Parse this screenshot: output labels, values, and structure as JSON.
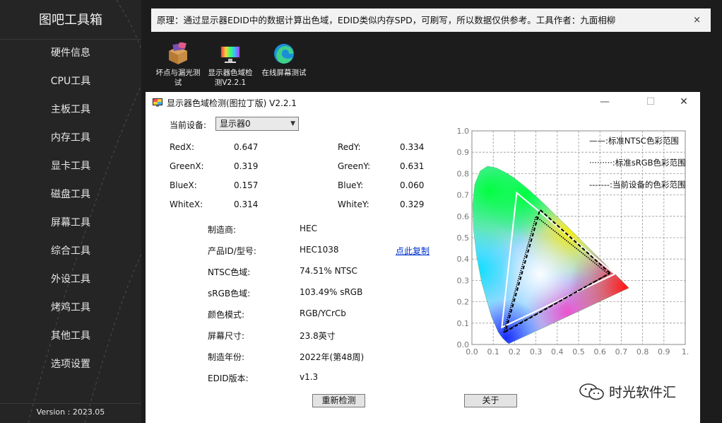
{
  "sidebar": {
    "title": "图吧工具箱",
    "items": [
      {
        "label": "硬件信息"
      },
      {
        "label": "CPU工具"
      },
      {
        "label": "主板工具"
      },
      {
        "label": "内存工具"
      },
      {
        "label": "显卡工具"
      },
      {
        "label": "磁盘工具"
      },
      {
        "label": "屏幕工具"
      },
      {
        "label": "综合工具"
      },
      {
        "label": "外设工具"
      },
      {
        "label": "烤鸡工具"
      },
      {
        "label": "其他工具"
      },
      {
        "label": "选项设置"
      }
    ],
    "version": "Version : 2023.05"
  },
  "infobar": {
    "text": "原理：通过显示器EDID中的数据计算出色域，EDID类似内存SPD，可刷写，所以数据仅供参考。工具作者：九面相柳",
    "close": "×"
  },
  "shortcuts": [
    {
      "line1": "坏点与漏光测",
      "line2": "试",
      "icon": "box-tool-icon"
    },
    {
      "line1": "显示器色域检",
      "line2": "测V2.2.1",
      "icon": "monitor-icon"
    },
    {
      "line1": "在线屏幕测试",
      "line2": "",
      "icon": "edge-browser-icon"
    }
  ],
  "window": {
    "title": "显示器色域检测(图拉丁版) V2.2.1",
    "minimize": "—",
    "maximize": "☐",
    "close": "✕",
    "device_label": "当前设备:",
    "device_value": "显示器0",
    "coords": {
      "red_x": {
        "label": "RedX:",
        "value": "0.647"
      },
      "red_y": {
        "label": "RedY:",
        "value": "0.334"
      },
      "green_x": {
        "label": "GreenX:",
        "value": "0.319"
      },
      "green_y": {
        "label": "GreenY:",
        "value": "0.631"
      },
      "blue_x": {
        "label": "BlueX:",
        "value": "0.157"
      },
      "blue_y": {
        "label": "BlueY:",
        "value": "0.060"
      },
      "white_x": {
        "label": "WhiteX:",
        "value": "0.314"
      },
      "white_y": {
        "label": "WhiteY:",
        "value": "0.329"
      }
    },
    "info": [
      {
        "label": "制造商:",
        "value": "HEC"
      },
      {
        "label": "产品ID/型号:",
        "value": "HEC1038"
      },
      {
        "label": "NTSC色域:",
        "value": "74.51% NTSC"
      },
      {
        "label": "sRGB色域:",
        "value": "103.49% sRGB"
      },
      {
        "label": "颜色模式:",
        "value": "RGB/YCrCb"
      },
      {
        "label": "屏幕尺寸:",
        "value": "23.8英寸"
      },
      {
        "label": "制造年份:",
        "value": "2022年(第48周)"
      },
      {
        "label": "EDID版本:",
        "value": "v1.3"
      }
    ],
    "copy_link": "点此复制",
    "redetect_button": "重新检测",
    "about_button": "关于"
  },
  "chart_data": {
    "type": "scatter",
    "title": "",
    "xlabel": "",
    "ylabel": "",
    "xlim": [
      0,
      1
    ],
    "ylim": [
      0,
      1
    ],
    "x_ticks": [
      "0.0",
      "0.1",
      "0.2",
      "0.3",
      "0.4",
      "0.5",
      "0.6",
      "0.7",
      "0.8",
      "0.9",
      "1."
    ],
    "y_ticks": [
      "0.0",
      "0.1",
      "0.2",
      "0.3",
      "0.4",
      "0.5",
      "0.6",
      "0.7",
      "0.8",
      "0.9",
      "1.0"
    ],
    "grid": true,
    "legend_position": "top-right",
    "series": [
      {
        "name": "标准NTSC色彩范围",
        "legend_text": "——:标准NTSC色彩范围",
        "points": [
          [
            0.67,
            0.33
          ],
          [
            0.21,
            0.71
          ],
          [
            0.14,
            0.08
          ],
          [
            0.67,
            0.33
          ]
        ],
        "color": "#ffffff"
      },
      {
        "name": "标准sRGB色彩范围",
        "legend_text": "·········:标准sRGB色彩范围",
        "points": [
          [
            0.64,
            0.33
          ],
          [
            0.3,
            0.6
          ],
          [
            0.15,
            0.06
          ],
          [
            0.64,
            0.33
          ]
        ],
        "color": "#000000"
      },
      {
        "name": "当前设备的色彩范围",
        "legend_text": "-------:当前设备的色彩范围",
        "points": [
          [
            0.647,
            0.334
          ],
          [
            0.319,
            0.631
          ],
          [
            0.157,
            0.06
          ],
          [
            0.647,
            0.334
          ]
        ],
        "color": "#000000"
      }
    ]
  },
  "watermark": {
    "text": "时光软件汇",
    "icon": "wechat-icon"
  }
}
